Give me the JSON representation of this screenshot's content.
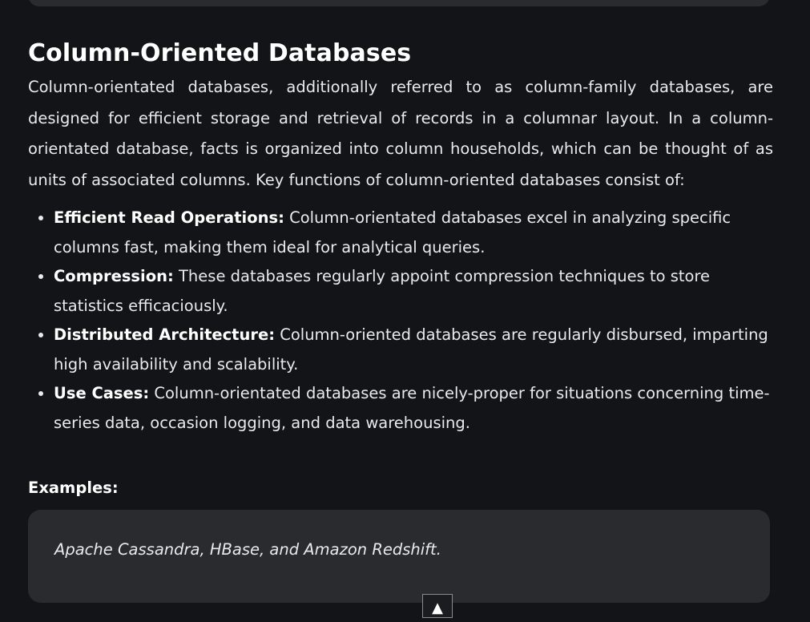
{
  "section": {
    "title": "Column-Oriented Databases",
    "intro": "Column-orientated databases, additionally referred to as column-family databases, are designed for efficient storage and retrieval of records in a columnar layout. In a column-orientated database, facts is organized into column households, which can be thought of as units of associated columns. Key functions of column-oriented databases consist of:",
    "features": [
      {
        "term": "Efficient Read Operations:",
        "text": " Column-orientated databases excel in analyzing specific columns fast, making them ideal for analytical queries."
      },
      {
        "term": "Compression:",
        "text": " These databases regularly appoint compression techniques to store statistics efficaciously."
      },
      {
        "term": "Distributed Architecture:",
        "text": " Column-oriented databases are regularly disbursed, imparting high availability and scalability."
      },
      {
        "term": "Use Cases:",
        "text": " Column-orientated databases are nicely-proper for situations concerning time-series data, occasion logging, and data warehousing."
      }
    ],
    "examples_heading": "Examples:",
    "examples_text": "Apache Cassandra, HBase, and Amazon Redshift."
  },
  "scroll_top": {
    "icon": "up-triangle-icon",
    "glyph": "▲"
  },
  "colors": {
    "background": "#131417",
    "card": "#2a2b2f",
    "text": "#e9eaec"
  }
}
